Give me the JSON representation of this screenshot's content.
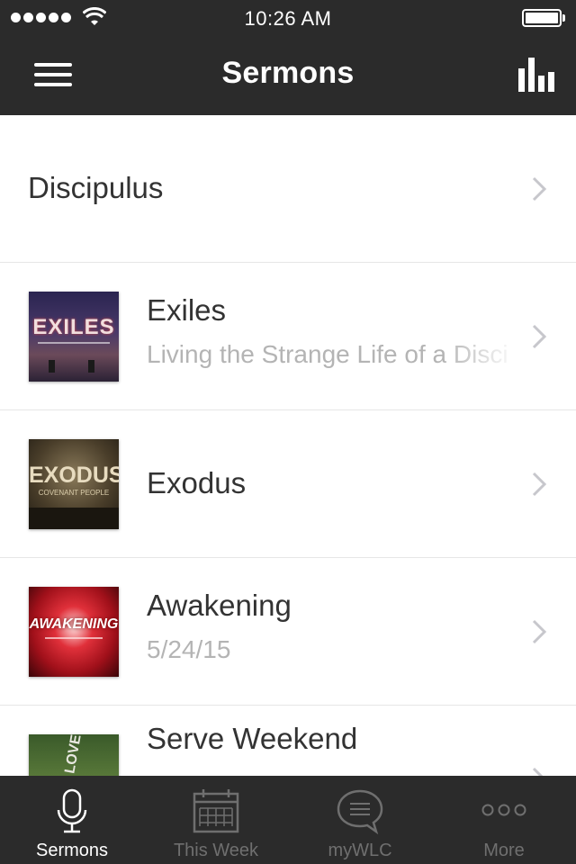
{
  "status_bar": {
    "time": "10:26 AM"
  },
  "nav": {
    "title": "Sermons"
  },
  "list": {
    "first_item": {
      "title": "Discipulus"
    },
    "items": [
      {
        "title": "Exiles",
        "subtitle": "Living the Strange Life of a Disci",
        "thumb_text": "EXILES",
        "thumb_icon": "exiles-artwork"
      },
      {
        "title": "Exodus",
        "subtitle": "",
        "thumb_text": "EXODUS",
        "thumb_caption": "COVENANT PEOPLE",
        "thumb_icon": "exodus-artwork"
      },
      {
        "title": "Awakening",
        "subtitle": "5/24/15",
        "thumb_text": "AWAKENING",
        "thumb_icon": "awakening-artwork"
      },
      {
        "title": "Serve Weekend",
        "subtitle": "",
        "thumb_text": "LOVE",
        "thumb_icon": "serve-weekend-artwork"
      }
    ]
  },
  "tabs": [
    {
      "label": "Sermons",
      "icon": "microphone-icon",
      "active": true
    },
    {
      "label": "This Week",
      "icon": "calendar-icon",
      "active": false
    },
    {
      "label": "myWLC",
      "icon": "chat-bubble-icon",
      "active": false
    },
    {
      "label": "More",
      "icon": "more-dots-icon",
      "active": false
    }
  ],
  "colors": {
    "bar_bg": "#2b2b2b",
    "active_tab": "#ffffff",
    "inactive_tab": "#6f6f6f",
    "subtitle": "#b4b4b4"
  }
}
